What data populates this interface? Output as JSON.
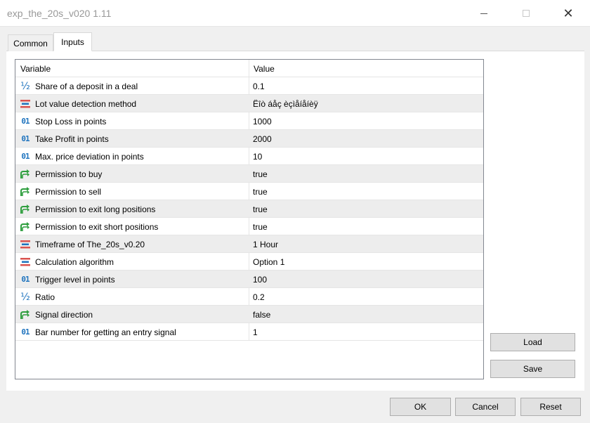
{
  "window": {
    "title": "exp_the_20s_v020 1.11"
  },
  "tabs": [
    {
      "label": "Common",
      "active": false
    },
    {
      "label": "Inputs",
      "active": true
    }
  ],
  "table": {
    "headers": {
      "variable": "Variable",
      "value": "Value"
    },
    "rows": [
      {
        "icon": "fraction-icon",
        "variable": "Share of a deposit in a deal",
        "value": "0.1"
      },
      {
        "icon": "enum-icon",
        "variable": "Lot value detection method",
        "value": "Ëîò áåç èçìåíåíèÿ"
      },
      {
        "icon": "integer-icon",
        "variable": "Stop Loss in points",
        "value": "1000"
      },
      {
        "icon": "integer-icon",
        "variable": "Take Profit in points",
        "value": "2000"
      },
      {
        "icon": "integer-icon",
        "variable": "Max. price deviation in points",
        "value": "10"
      },
      {
        "icon": "boolean-icon",
        "variable": "Permission to buy",
        "value": "true"
      },
      {
        "icon": "boolean-icon",
        "variable": "Permission to sell",
        "value": "true"
      },
      {
        "icon": "boolean-icon",
        "variable": "Permission to exit long positions",
        "value": "true"
      },
      {
        "icon": "boolean-icon",
        "variable": "Permission to exit short positions",
        "value": "true"
      },
      {
        "icon": "enum-icon",
        "variable": "Timeframe of The_20s_v0.20",
        "value": "1 Hour"
      },
      {
        "icon": "enum-icon",
        "variable": "Calculation algorithm",
        "value": "Option 1"
      },
      {
        "icon": "integer-icon",
        "variable": "Trigger level in points",
        "value": "100"
      },
      {
        "icon": "fraction-icon",
        "variable": "Ratio",
        "value": "0.2"
      },
      {
        "icon": "boolean-icon",
        "variable": "Signal direction",
        "value": "false"
      },
      {
        "icon": "integer-icon",
        "variable": "Bar number for getting an entry signal",
        "value": "1"
      }
    ]
  },
  "side_buttons": {
    "load": "Load",
    "save": "Save"
  },
  "footer_buttons": {
    "ok": "OK",
    "cancel": "Cancel",
    "reset": "Reset"
  },
  "icon_glyphs": {
    "integer": "01",
    "fraction": "½"
  },
  "colors": {
    "icon_blue": "#1e73be",
    "icon_green": "#2e9e3e",
    "icon_red": "#d9534f",
    "row_alt": "#ededed"
  }
}
